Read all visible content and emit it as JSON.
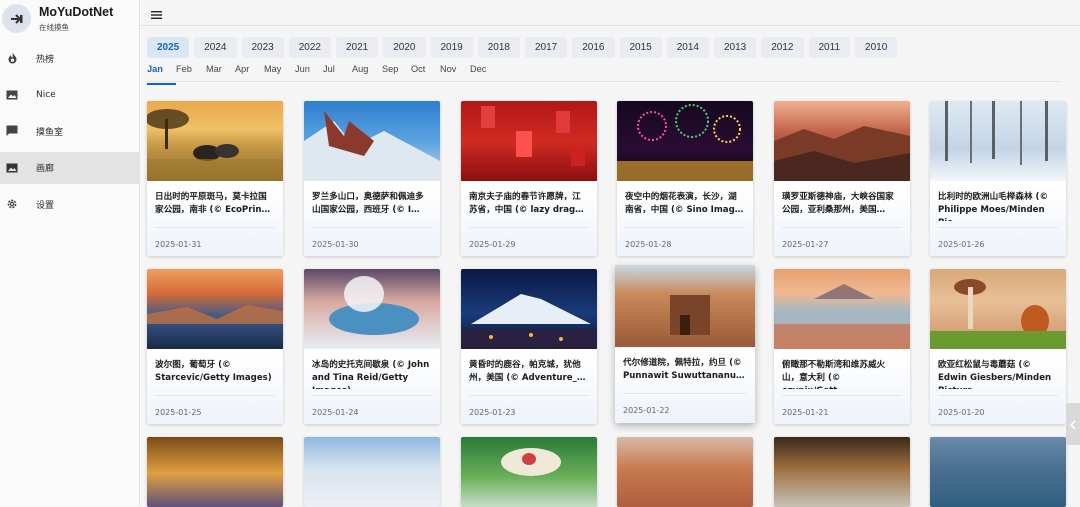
{
  "app": {
    "title": "MoYuDotNet",
    "subtitle": "在线摸鱼"
  },
  "sidebar": {
    "items": [
      {
        "label": "热榜",
        "icon": "flame-icon"
      },
      {
        "label": "Nice",
        "icon": "image-icon"
      },
      {
        "label": "摸鱼室",
        "icon": "chat-icon"
      },
      {
        "label": "画廊",
        "icon": "gallery-icon",
        "active": true
      },
      {
        "label": "设置",
        "icon": "gear-icon"
      }
    ]
  },
  "years": [
    "2025",
    "2024",
    "2023",
    "2022",
    "2021",
    "2020",
    "2019",
    "2018",
    "2017",
    "2016",
    "2015",
    "2014",
    "2013",
    "2012",
    "2011",
    "2010"
  ],
  "months": [
    "Jan",
    "Feb",
    "Mar",
    "Apr",
    "May",
    "Jun",
    "Jul",
    "Aug",
    "Sep",
    "Oct",
    "Nov",
    "Dec"
  ],
  "accent": "#1565c0",
  "gallery": [
    {
      "caption": "日出时的平原斑马，莫卡拉国家公园，南非 (© EcoPrin…",
      "date": "2025-01-31"
    },
    {
      "caption": "罗兰多山口，奥德萨和佩迪多山国家公园，西班牙 (© I…",
      "date": "2025-01-30"
    },
    {
      "caption": "南京夫子庙的春节许愿牌，江苏省，中国 (© lazy drag…",
      "date": "2025-01-29"
    },
    {
      "caption": "夜空中的烟花表演，长沙，湖南省，中国 (© Sino Imag…",
      "date": "2025-01-28"
    },
    {
      "caption": "璜罗亚斯德神庙，大峡谷国家公园，亚利桑那州，美国…",
      "date": "2025-01-27"
    },
    {
      "caption": "比利时的欧洲山毛榉森林 (© Philippe Moes/Minden Pic…",
      "date": "2025-01-26"
    },
    {
      "caption": "波尔图，葡萄牙 (© Starcevic/Getty Images)",
      "date": "2025-01-25"
    },
    {
      "caption": "冰岛的史托克间歇泉 (© John and Tina Reid/Getty Images)",
      "date": "2025-01-24"
    },
    {
      "caption": "黄昏时的鹿谷，帕克城，犹他州，美国 (© Adventure_…",
      "date": "2025-01-23"
    },
    {
      "caption": "代尔修道院，佩特拉，约旦 (© Punnawit Suwuttananu…",
      "date": "2025-01-22"
    },
    {
      "caption": "俯瞰那不勒斯湾和维苏威火山，意大利 (© ezypix/Gett…",
      "date": "2025-01-21"
    },
    {
      "caption": "欧亚红松鼠与毒蘑菇 (© Edwin Giesbers/Minden Picture…",
      "date": "2025-01-20"
    },
    {
      "caption": "",
      "date": ""
    },
    {
      "caption": "",
      "date": ""
    },
    {
      "caption": "",
      "date": ""
    },
    {
      "caption": "",
      "date": ""
    },
    {
      "caption": "",
      "date": ""
    },
    {
      "caption": "",
      "date": ""
    }
  ]
}
